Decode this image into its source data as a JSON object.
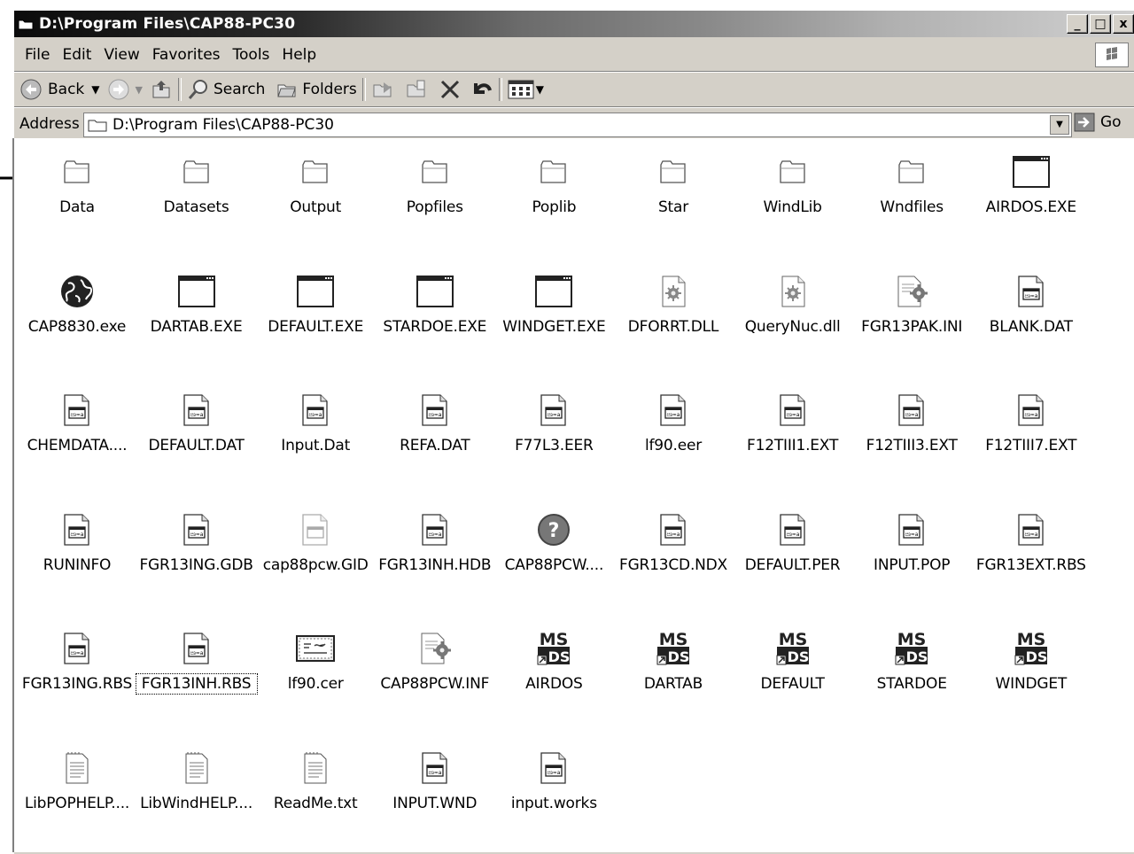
{
  "window": {
    "title": "D:\\Program Files\\CAP88-PC30",
    "buttons": {
      "minimize": "_",
      "maximize": "□",
      "close": "x"
    }
  },
  "menu": [
    "File",
    "Edit",
    "View",
    "Favorites",
    "Tools",
    "Help"
  ],
  "toolbar": {
    "back_label": "Back",
    "search_label": "Search",
    "folders_label": "Folders"
  },
  "address": {
    "label": "Address",
    "value": "D:\\Program Files\\CAP88-PC30",
    "go_label": "Go"
  },
  "files": [
    {
      "label": "Data",
      "icon": "folder-icon"
    },
    {
      "label": "Datasets",
      "icon": "folder-icon"
    },
    {
      "label": "Output",
      "icon": "folder-icon"
    },
    {
      "label": "Popfiles",
      "icon": "folder-icon"
    },
    {
      "label": "Poplib",
      "icon": "folder-icon"
    },
    {
      "label": "Star",
      "icon": "folder-icon"
    },
    {
      "label": "WindLib",
      "icon": "folder-icon"
    },
    {
      "label": "Wndfiles",
      "icon": "folder-icon"
    },
    {
      "label": "AIRDOS.EXE",
      "icon": "exe-window-icon"
    },
    {
      "label": "CAP8830.exe",
      "icon": "globe-icon"
    },
    {
      "label": "DARTAB.EXE",
      "icon": "exe-window-icon"
    },
    {
      "label": "DEFAULT.EXE",
      "icon": "exe-window-icon"
    },
    {
      "label": "STARDOE.EXE",
      "icon": "exe-window-icon"
    },
    {
      "label": "WINDGET.EXE",
      "icon": "exe-window-icon"
    },
    {
      "label": "DFORRT.DLL",
      "icon": "dll-gear-icon"
    },
    {
      "label": "QueryNuc.dll",
      "icon": "dll-gear-icon"
    },
    {
      "label": "FGR13PAK.INI",
      "icon": "ini-settings-icon"
    },
    {
      "label": "BLANK.DAT",
      "icon": "generic-file-icon"
    },
    {
      "label": "CHEMDATA....",
      "icon": "generic-file-icon"
    },
    {
      "label": "DEFAULT.DAT",
      "icon": "generic-file-icon"
    },
    {
      "label": "Input.Dat",
      "icon": "generic-file-icon"
    },
    {
      "label": "REFA.DAT",
      "icon": "generic-file-icon"
    },
    {
      "label": "F77L3.EER",
      "icon": "generic-file-icon"
    },
    {
      "label": "lf90.eer",
      "icon": "generic-file-icon"
    },
    {
      "label": "F12TIII1.EXT",
      "icon": "generic-file-icon"
    },
    {
      "label": "F12TIII3.EXT",
      "icon": "generic-file-icon"
    },
    {
      "label": "F12TIII7.EXT",
      "icon": "generic-file-icon"
    },
    {
      "label": "RUNINFO",
      "icon": "generic-file-icon"
    },
    {
      "label": "FGR13ING.GDB",
      "icon": "generic-file-icon"
    },
    {
      "label": "cap88pcw.GID",
      "icon": "hidden-file-icon"
    },
    {
      "label": "FGR13INH.HDB",
      "icon": "generic-file-icon"
    },
    {
      "label": "CAP88PCW....",
      "icon": "help-icon"
    },
    {
      "label": "FGR13CD.NDX",
      "icon": "generic-file-icon"
    },
    {
      "label": "DEFAULT.PER",
      "icon": "generic-file-icon"
    },
    {
      "label": "INPUT.POP",
      "icon": "generic-file-icon"
    },
    {
      "label": "FGR13EXT.RBS",
      "icon": "generic-file-icon"
    },
    {
      "label": "FGR13ING.RBS",
      "icon": "generic-file-icon"
    },
    {
      "label": "FGR13INH.RBS",
      "icon": "generic-file-icon",
      "focused": true
    },
    {
      "label": "lf90.cer",
      "icon": "certificate-icon"
    },
    {
      "label": "CAP88PCW.INF",
      "icon": "ini-settings-icon"
    },
    {
      "label": "AIRDOS",
      "icon": "msdos-shortcut-icon"
    },
    {
      "label": "DARTAB",
      "icon": "msdos-shortcut-icon"
    },
    {
      "label": "DEFAULT",
      "icon": "msdos-shortcut-icon"
    },
    {
      "label": "STARDOE",
      "icon": "msdos-shortcut-icon"
    },
    {
      "label": "WINDGET",
      "icon": "msdos-shortcut-icon"
    },
    {
      "label": "LibPOPHELP....",
      "icon": "text-file-icon"
    },
    {
      "label": "LibWindHELP....",
      "icon": "text-file-icon"
    },
    {
      "label": "ReadMe.txt",
      "icon": "text-file-icon"
    },
    {
      "label": "INPUT.WND",
      "icon": "generic-file-icon"
    },
    {
      "label": "input.works",
      "icon": "generic-file-icon"
    }
  ]
}
